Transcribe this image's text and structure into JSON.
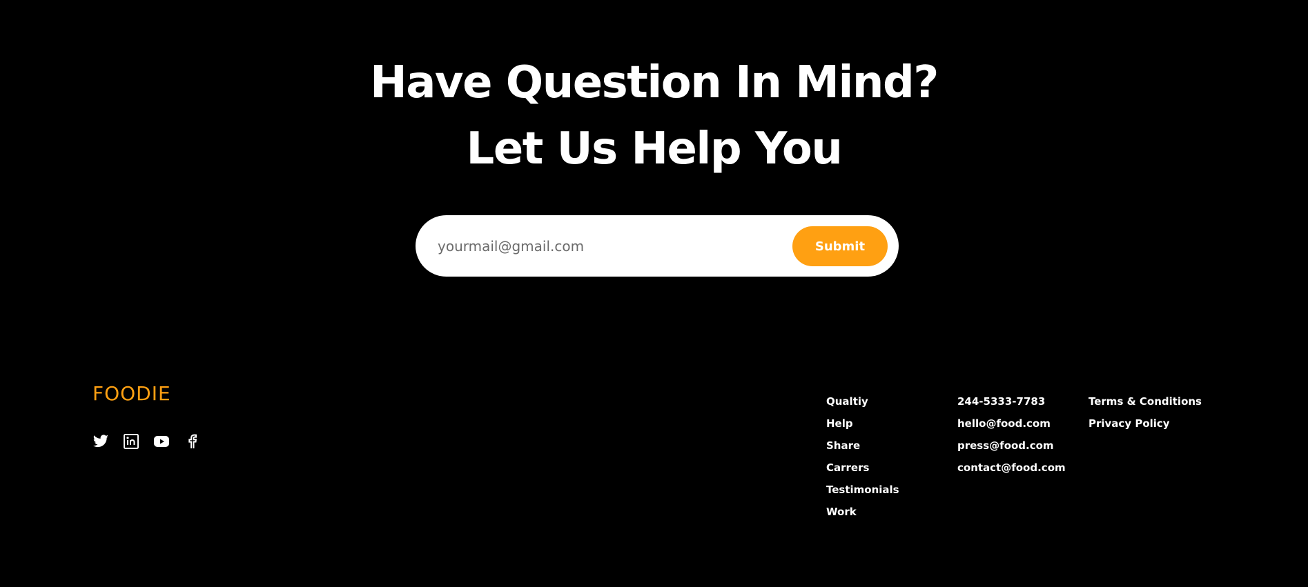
{
  "hero": {
    "line1": "Have Question In Mind?",
    "line2": "Let Us Help You"
  },
  "subscribe": {
    "placeholder": "yourmail@gmail.com",
    "value": "",
    "submit_label": "Submit"
  },
  "footer": {
    "brand": "FOODIE",
    "social_icons": [
      "twitter-icon",
      "linkedin-icon",
      "youtube-icon",
      "facebook-icon"
    ],
    "links": [
      "Qualtiy",
      "Help",
      "Share",
      "Carrers",
      "Testimonials",
      "Work"
    ],
    "contacts": [
      "244-5333-7783",
      "hello@food.com",
      "press@food.com",
      "contact@food.com"
    ],
    "legal": [
      "Terms & Conditions",
      "Privacy Policy"
    ]
  },
  "colors": {
    "background": "#000000",
    "accent": "#FFA012",
    "text": "#FFFFFF"
  }
}
